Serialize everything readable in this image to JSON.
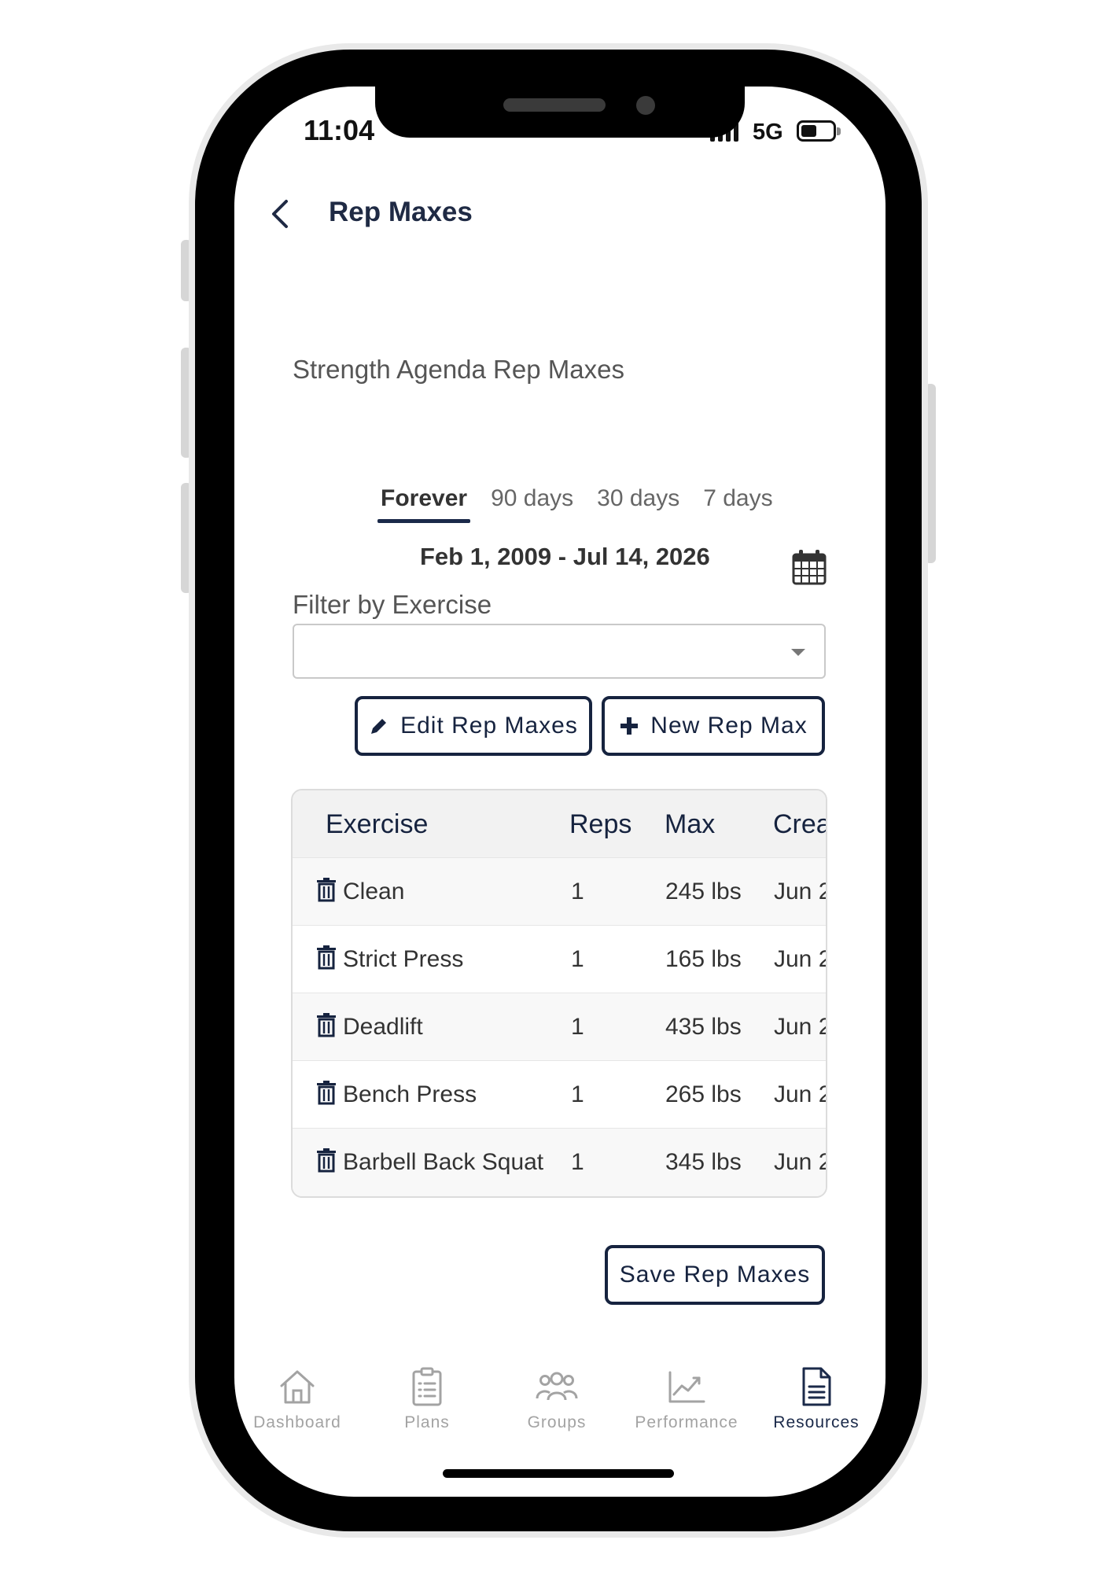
{
  "status_bar": {
    "time": "11:04",
    "network": "5G"
  },
  "header": {
    "title": "Rep Maxes"
  },
  "subtitle": "Strength Agenda Rep Maxes",
  "tabs": [
    {
      "label": "Forever",
      "active": true
    },
    {
      "label": "90 days",
      "active": false
    },
    {
      "label": "30 days",
      "active": false
    },
    {
      "label": "7 days",
      "active": false
    }
  ],
  "date_range": "Feb 1, 2009 - Jul 14, 2026",
  "filter": {
    "label": "Filter by Exercise",
    "value": ""
  },
  "buttons": {
    "edit": "Edit Rep Maxes",
    "new": "New Rep Max",
    "save": "Save Rep Maxes"
  },
  "table": {
    "columns": [
      "Exercise",
      "Reps",
      "Max",
      "Crea"
    ],
    "rows": [
      {
        "exercise": "Clean",
        "reps": "1",
        "max": "245 lbs",
        "created": "Jun 2"
      },
      {
        "exercise": "Strict Press",
        "reps": "1",
        "max": "165 lbs",
        "created": "Jun 2"
      },
      {
        "exercise": "Deadlift",
        "reps": "1",
        "max": "435 lbs",
        "created": "Jun 2"
      },
      {
        "exercise": "Bench Press",
        "reps": "1",
        "max": "265 lbs",
        "created": "Jun 2"
      },
      {
        "exercise": "Barbell Back Squat",
        "reps": "1",
        "max": "345 lbs",
        "created": "Jun 2"
      }
    ]
  },
  "nav": [
    {
      "label": "Dashboard",
      "icon": "home-icon",
      "active": false
    },
    {
      "label": "Plans",
      "icon": "clipboard-icon",
      "active": false
    },
    {
      "label": "Groups",
      "icon": "users-icon",
      "active": false
    },
    {
      "label": "Performance",
      "icon": "chart-icon",
      "active": false
    },
    {
      "label": "Resources",
      "icon": "document-icon",
      "active": true
    }
  ],
  "colors": {
    "accent": "#16233f",
    "inactive": "#a3a3a3"
  }
}
